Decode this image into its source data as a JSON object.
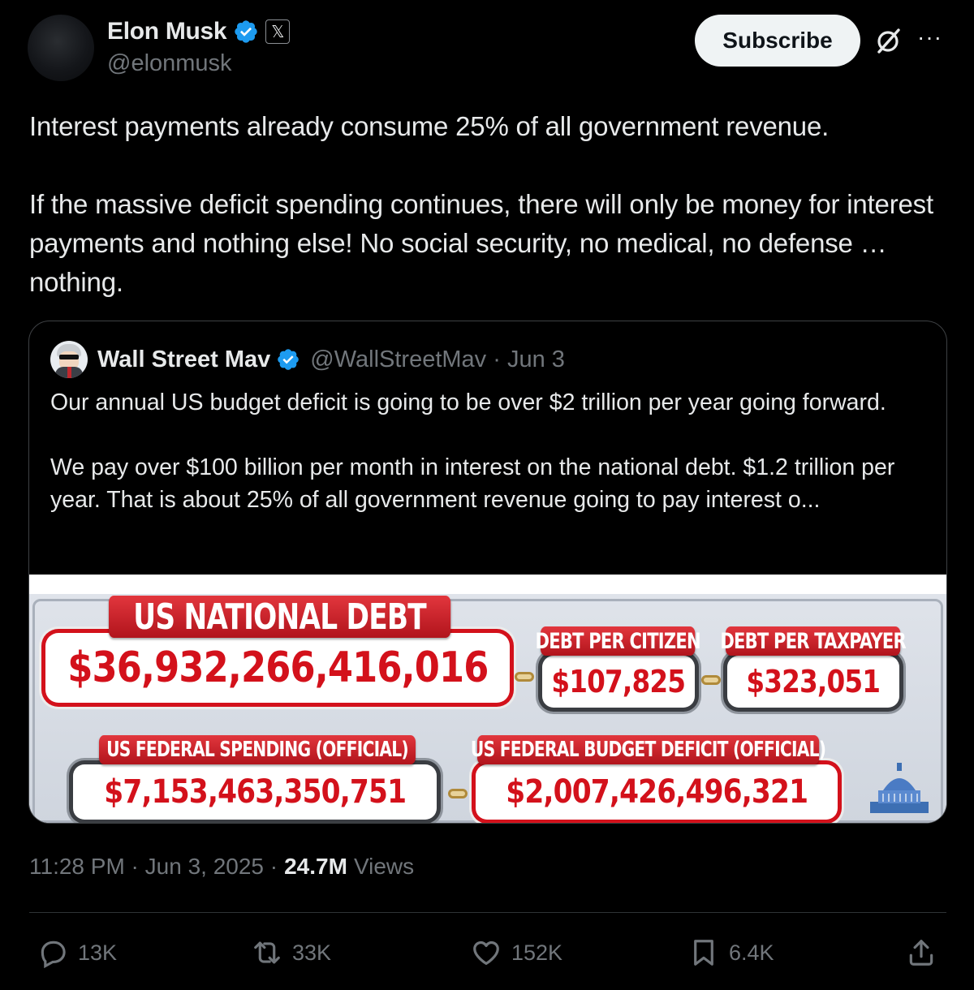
{
  "post": {
    "author_name": "Elon Musk",
    "author_handle": "@elonmusk",
    "affiliation_badge": "𝕏",
    "subscribe_label": "Subscribe",
    "more_label": "···",
    "text": "Interest payments already consume 25% of all government revenue.\n\nIf the massive deficit spending continues, there will only be money for interest payments and nothing else! No social security, no medical, no defense … nothing."
  },
  "quote": {
    "author_name": "Wall Street Mav",
    "author_handle": "@WallStreetMav · Jun 3",
    "text": "Our annual US budget deficit is going to be over $2 trillion per year going forward.\n\nWe pay over $100 billion per month in interest on the national debt. $1.2 trillion per year. That is about 25% of all government revenue going to pay interest o...",
    "image": {
      "national_debt_label": "US NATIONAL DEBT",
      "national_debt_value": "$36,932,266,416,016",
      "per_citizen_label": "DEBT PER CITIZEN",
      "per_citizen_value": "$107,825",
      "per_taxpayer_label": "DEBT PER TAXPAYER",
      "per_taxpayer_value": "$323,051",
      "spending_label": "US FEDERAL SPENDING (OFFICIAL)",
      "spending_value": "$7,153,463,350,751",
      "deficit_label": "US FEDERAL BUDGET DEFICIT (OFFICIAL)",
      "deficit_value": "$2,007,426,496,321"
    }
  },
  "meta": {
    "timestamp": "11:28 PM · Jun 3, 2025 ·",
    "views_count": "24.7M",
    "views_label": "Views"
  },
  "actions": {
    "replies": "13K",
    "reposts": "33K",
    "likes": "152K",
    "bookmarks": "6.4K"
  },
  "colors": {
    "background": "#000000",
    "verified_blue": "#1d9bf0",
    "secondary_text": "#71767b",
    "debt_red": "#d3111b"
  },
  "icons": [
    "verified-icon",
    "grok-icon",
    "more-icon",
    "reply-icon",
    "repost-icon",
    "like-icon",
    "bookmark-icon",
    "share-icon"
  ]
}
